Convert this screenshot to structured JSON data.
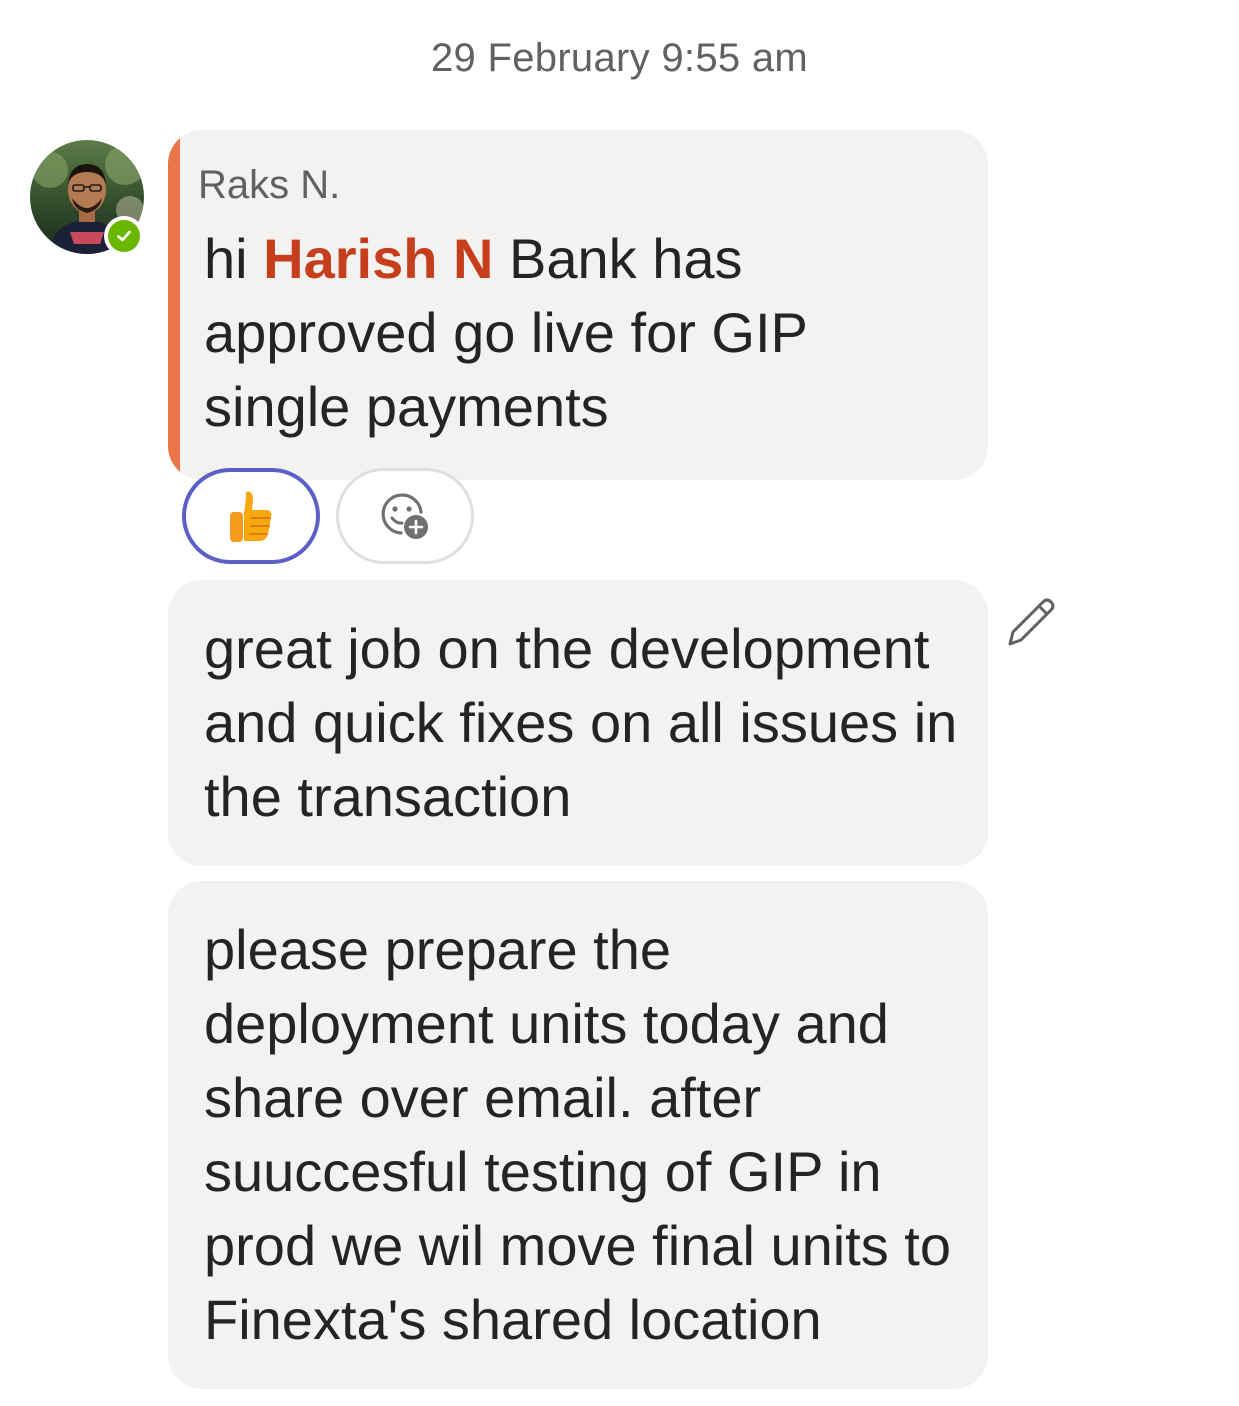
{
  "timestamp": "29 February 9:55 am",
  "sender": {
    "name": "Raks N.",
    "avatar": "user-avatar",
    "presence": "available",
    "presence_color": "#6bb700"
  },
  "messages": [
    {
      "prefix": "hi ",
      "mention": "Harish N",
      "text": " Bank has approved go live for GIP single payments",
      "accent_color": "#e97548",
      "reactions": [
        {
          "icon": "thumbs-up-icon",
          "selected": true
        },
        {
          "icon": "add-reaction-icon",
          "selected": false
        }
      ]
    },
    {
      "text": "great job on the development and quick fixes on all issues in the transaction"
    },
    {
      "text": "please prepare the deployment units today and share over email. after suuccesful testing of GIP in prod we wil move final units to Finexta's shared location"
    }
  ],
  "colors": {
    "bubble_bg": "#f3f2f1",
    "mention": "#c73e1d",
    "selected_reaction_border": "#5b5fc7"
  }
}
